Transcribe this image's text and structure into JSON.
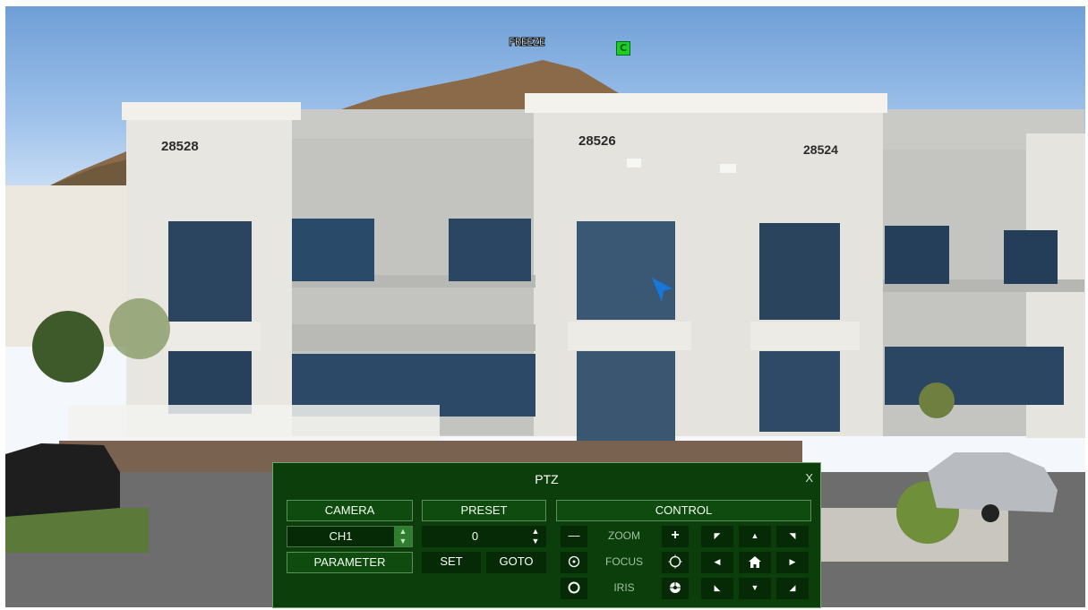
{
  "overlay": {
    "freeze": "FREEZE",
    "channel_badge": "C"
  },
  "building": {
    "numbers": [
      "28528",
      "28526",
      "28524"
    ]
  },
  "ptz": {
    "title": "PTZ",
    "close": "X",
    "camera": {
      "header": "CAMERA",
      "value": "CH1",
      "parameter": "PARAMETER"
    },
    "preset": {
      "header": "PRESET",
      "value": "0",
      "set": "SET",
      "goto": "GOTO"
    },
    "control": {
      "header": "CONTROL",
      "zoom": "ZOOM",
      "focus": "FOCUS",
      "iris": "IRIS",
      "minus": "—",
      "plus": "+"
    }
  }
}
